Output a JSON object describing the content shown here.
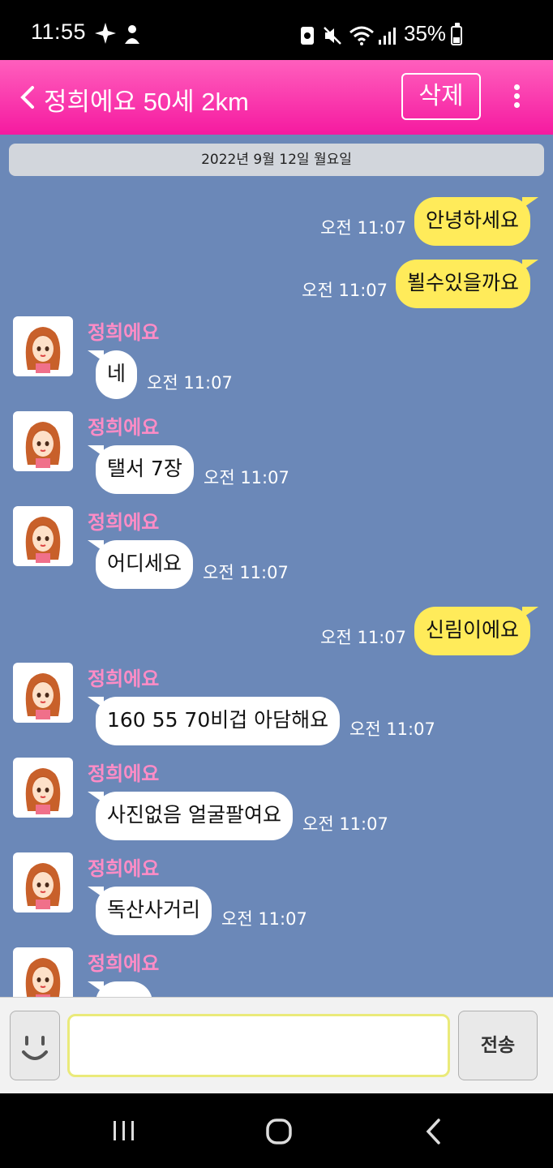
{
  "status_bar": {
    "time": "11:55",
    "battery": "35%",
    "battery_level": 0.35
  },
  "header": {
    "title": "정희에요 50세 2km",
    "delete_label": "삭제"
  },
  "date_divider": "2022년 9월 12일 월요일",
  "messages": [
    {
      "side": "me",
      "text": "안녕하세요",
      "time": "오전 11:07"
    },
    {
      "side": "me",
      "text": "뵐수있을까요",
      "time": "오전 11:07"
    },
    {
      "side": "them",
      "sender": "정희에요",
      "text": "네",
      "time": "오전 11:07"
    },
    {
      "side": "them",
      "sender": "정희에요",
      "text": "탤서 7장",
      "time": "오전 11:07"
    },
    {
      "side": "them",
      "sender": "정희에요",
      "text": "어디세요",
      "time": "오전 11:07"
    },
    {
      "side": "me",
      "text": "신림이에요",
      "time": "오전 11:07"
    },
    {
      "side": "them",
      "sender": "정희에요",
      "text": "160 55 70비겁 아담해요",
      "time": "오전 11:07"
    },
    {
      "side": "them",
      "sender": "정희에요",
      "text": "사진없음 얼굴팔여요",
      "time": "오전 11:07"
    },
    {
      "side": "them",
      "sender": "정희에요",
      "text": "독산사거리",
      "time": "오전 11:07"
    },
    {
      "side": "them",
      "sender": "정희에요",
      "text": "",
      "time": ""
    }
  ],
  "input": {
    "send_label": "전송",
    "placeholder": ""
  },
  "colors": {
    "header": "#f51aa0",
    "chat_bg": "#6b88b8",
    "my_bubble": "#ffeb5a",
    "sender_name": "#ff8cc6"
  }
}
